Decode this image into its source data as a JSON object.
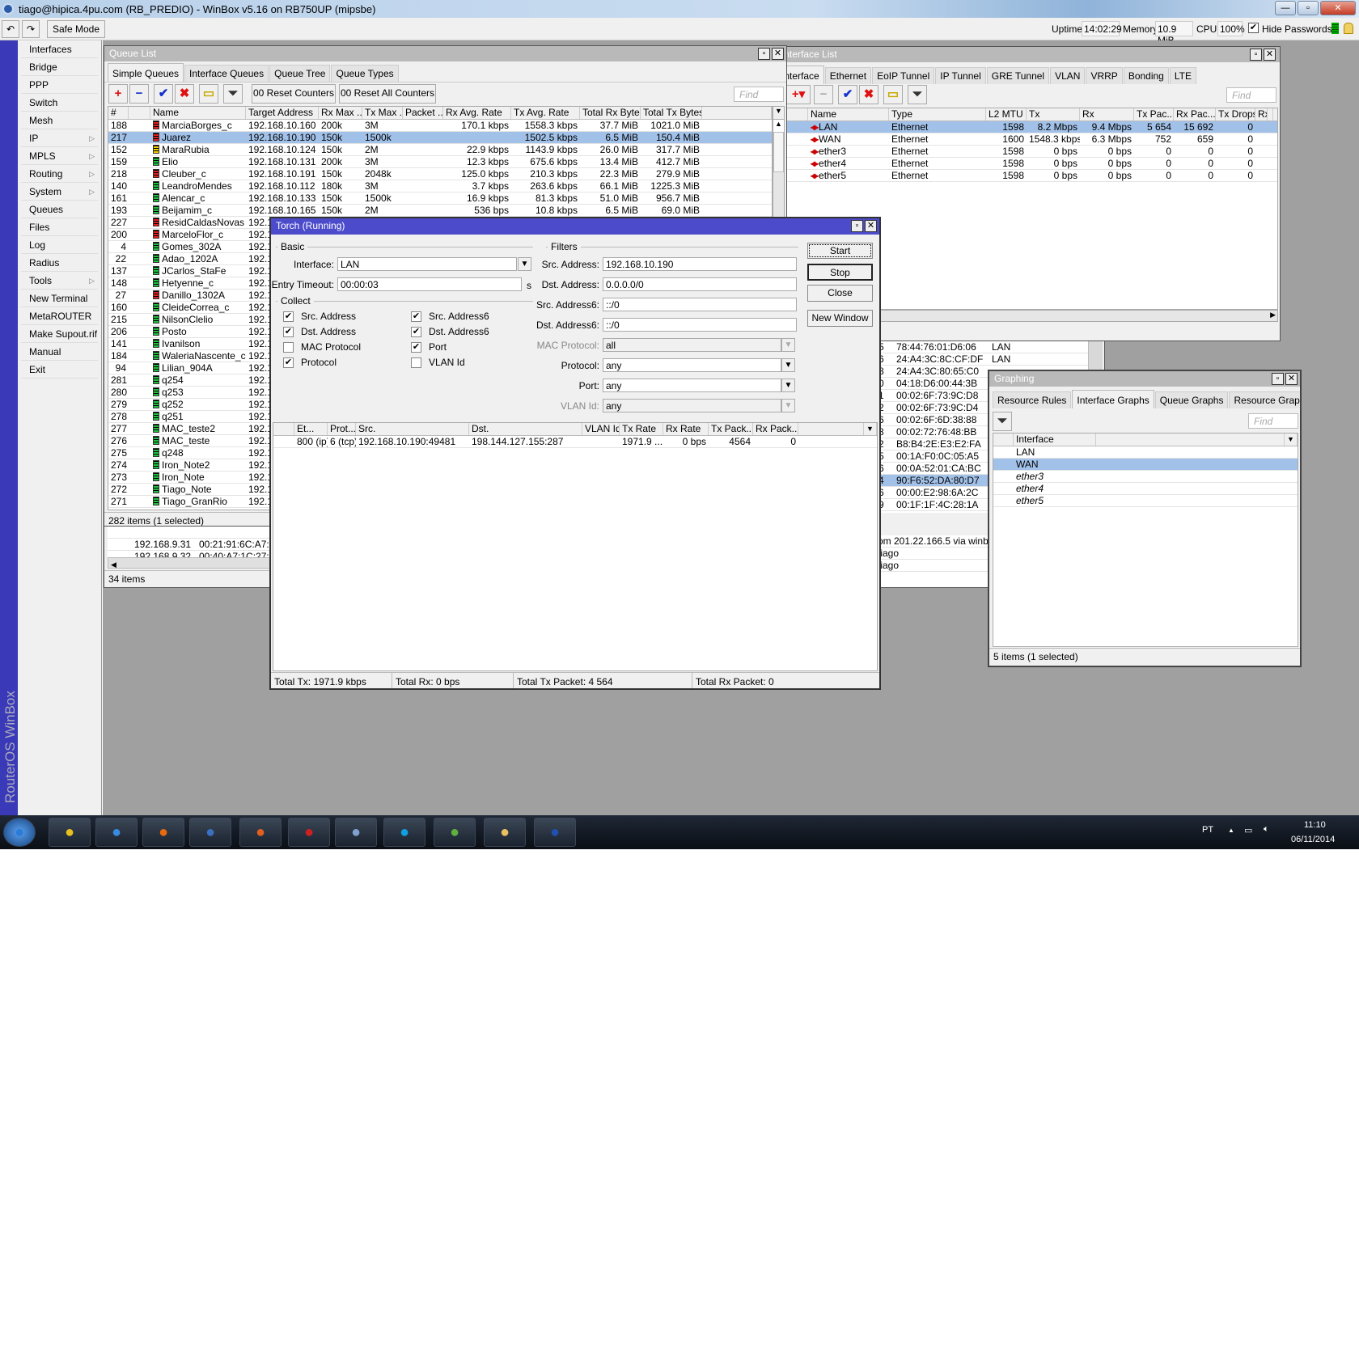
{
  "app": {
    "title": "tiago@hipica.4pu.com (RB_PREDIO) - WinBox v5.16 on RB750UP (mipsbe)",
    "minimize": "—",
    "maximize": "▫",
    "close": "✕"
  },
  "toolbar": {
    "undo": "↶",
    "redo": "↷",
    "safe_mode": "Safe Mode",
    "uptime_label": "Uptime:",
    "uptime": "14:02:29",
    "memory_label": "Memory:",
    "memory": "10.9 MiB",
    "cpu_label": "CPU:",
    "cpu": "100%",
    "hide_passwords": "Hide Passwords",
    "hide_passwords_checked": true
  },
  "sidebar": {
    "brand": "RouterOS WinBox",
    "items": [
      {
        "label": "Interfaces"
      },
      {
        "label": "Bridge"
      },
      {
        "label": "PPP"
      },
      {
        "label": "Switch"
      },
      {
        "label": "Mesh"
      },
      {
        "label": "IP",
        "submenu": true
      },
      {
        "label": "MPLS",
        "submenu": true
      },
      {
        "label": "Routing",
        "submenu": true
      },
      {
        "label": "System",
        "submenu": true
      },
      {
        "label": "Queues"
      },
      {
        "label": "Files"
      },
      {
        "label": "Log"
      },
      {
        "label": "Radius"
      },
      {
        "label": "Tools",
        "submenu": true
      },
      {
        "label": "New Terminal"
      },
      {
        "label": "MetaROUTER"
      },
      {
        "label": "Make Supout.rif"
      },
      {
        "label": "Manual"
      },
      {
        "label": "Exit"
      }
    ]
  },
  "colors": {
    "active_title": "#4b4bcc",
    "selection": "#a2c1e8",
    "desktop": "#a0a0a0",
    "queue_red": "#e02020",
    "queue_yellow": "#f0d000",
    "queue_green": "#20c040"
  },
  "queue_list": {
    "title": "Queue List",
    "tabs": [
      "Simple Queues",
      "Interface Queues",
      "Queue Tree",
      "Queue Types"
    ],
    "reset_counters": "00 Reset Counters",
    "reset_all_counters": "00 Reset All Counters",
    "find_placeholder": "Find",
    "columns": [
      "#",
      "",
      "Name",
      "Target Address",
      "Rx Max ...",
      "Tx Max ...",
      "Packet ...",
      "Rx Avg. Rate",
      "Tx Avg. Rate",
      "Total Rx Bytes",
      "Total Tx Bytes"
    ],
    "rows": [
      {
        "id": "188",
        "status": "red",
        "name": "MarciaBorges_c",
        "target": "192.168.10.160",
        "rx_max": "200k",
        "tx_max": "3M",
        "packet": "",
        "rx_avg": "170.1 kbps",
        "tx_avg": "1558.3 kbps",
        "total_rx": "37.7 MiB",
        "total_tx": "1021.0 MiB"
      },
      {
        "id": "217",
        "status": "red",
        "name": "Juarez",
        "target": "192.168.10.190",
        "rx_max": "150k",
        "tx_max": "1500k",
        "packet": "",
        "rx_avg": "",
        "tx_avg": "1502.5 kbps",
        "total_rx": "6.5 MiB",
        "total_tx": "150.4 MiB",
        "selected": true
      },
      {
        "id": "152",
        "status": "yellow",
        "name": "MaraRubia",
        "target": "192.168.10.124",
        "rx_max": "150k",
        "tx_max": "2M",
        "packet": "",
        "rx_avg": "22.9 kbps",
        "tx_avg": "1143.9 kbps",
        "total_rx": "26.0 MiB",
        "total_tx": "317.7 MiB"
      },
      {
        "id": "159",
        "status": "green",
        "name": "Elio",
        "target": "192.168.10.131",
        "rx_max": "200k",
        "tx_max": "3M",
        "packet": "",
        "rx_avg": "12.3 kbps",
        "tx_avg": "675.6 kbps",
        "total_rx": "13.4 MiB",
        "total_tx": "412.7 MiB"
      },
      {
        "id": "218",
        "status": "red",
        "name": "Cleuber_c",
        "target": "192.168.10.191",
        "rx_max": "150k",
        "tx_max": "2048k",
        "packet": "",
        "rx_avg": "125.0 kbps",
        "tx_avg": "210.3 kbps",
        "total_rx": "22.3 MiB",
        "total_tx": "279.9 MiB"
      },
      {
        "id": "140",
        "status": "green",
        "name": "LeandroMendes",
        "target": "192.168.10.112",
        "rx_max": "180k",
        "tx_max": "3M",
        "packet": "",
        "rx_avg": "3.7 kbps",
        "tx_avg": "263.6 kbps",
        "total_rx": "66.1 MiB",
        "total_tx": "1225.3 MiB"
      },
      {
        "id": "161",
        "status": "green",
        "name": "Alencar_c",
        "target": "192.168.10.133",
        "rx_max": "150k",
        "tx_max": "1500k",
        "packet": "",
        "rx_avg": "16.9 kbps",
        "tx_avg": "81.3 kbps",
        "total_rx": "51.0 MiB",
        "total_tx": "956.7 MiB"
      },
      {
        "id": "193",
        "status": "green",
        "name": "Beijamim_c",
        "target": "192.168.10.165",
        "rx_max": "150k",
        "tx_max": "2M",
        "packet": "",
        "rx_avg": "536 bps",
        "tx_avg": "10.8 kbps",
        "total_rx": "6.5 MiB",
        "total_tx": "69.0 MiB"
      },
      {
        "id": "227",
        "status": "red",
        "name": "ResidCaldasNovas",
        "target": "192.1"
      },
      {
        "id": "200",
        "status": "red",
        "name": "MarceloFlor_c",
        "target": "192.1"
      },
      {
        "id": "4",
        "status": "green",
        "name": "Gomes_302A",
        "target": "192.1"
      },
      {
        "id": "22",
        "status": "green",
        "name": "Adao_1202A",
        "target": "192.1"
      },
      {
        "id": "137",
        "status": "green",
        "name": "JCarlos_StaFe",
        "target": "192.1"
      },
      {
        "id": "148",
        "status": "green",
        "name": "Hetyenne_c",
        "target": "192.1"
      },
      {
        "id": "27",
        "status": "red",
        "name": "Danillo_1302A",
        "target": "192.1"
      },
      {
        "id": "160",
        "status": "green",
        "name": "CleideCorrea_c",
        "target": "192.1"
      },
      {
        "id": "215",
        "status": "green",
        "name": "NilsonClelio",
        "target": "192.1"
      },
      {
        "id": "206",
        "status": "green",
        "name": "Posto",
        "target": "192.1"
      },
      {
        "id": "141",
        "status": "green",
        "name": "Ivanilson",
        "target": "192.1"
      },
      {
        "id": "184",
        "status": "green",
        "name": "WaleriaNascente_c",
        "target": "192.1"
      },
      {
        "id": "94",
        "status": "green",
        "name": "Lilian_904A",
        "target": "192.1"
      },
      {
        "id": "281",
        "status": "green",
        "name": "q254",
        "target": "192.1"
      },
      {
        "id": "280",
        "status": "green",
        "name": "q253",
        "target": "192.1"
      },
      {
        "id": "279",
        "status": "green",
        "name": "q252",
        "target": "192.1"
      },
      {
        "id": "278",
        "status": "green",
        "name": "q251",
        "target": "192.1"
      },
      {
        "id": "277",
        "status": "green",
        "name": "MAC_teste2",
        "target": "192.1"
      },
      {
        "id": "276",
        "status": "green",
        "name": "MAC_teste",
        "target": "192.1"
      },
      {
        "id": "275",
        "status": "green",
        "name": "q248",
        "target": "192.1"
      },
      {
        "id": "274",
        "status": "green",
        "name": "Iron_Note2",
        "target": "192.1"
      },
      {
        "id": "273",
        "status": "green",
        "name": "Iron_Note",
        "target": "192.1"
      },
      {
        "id": "272",
        "status": "green",
        "name": "Tiago_Note",
        "target": "192.1"
      },
      {
        "id": "271",
        "status": "green",
        "name": "Tiago_GranRio",
        "target": "192.1"
      }
    ],
    "status": "282 items (1 selected)"
  },
  "arp_partial": {
    "rows": [
      {
        "address": "192.168.9.31",
        "mac": "00:21:91:6C:A7:91"
      },
      {
        "address": "192.168.9.32",
        "mac": "00:40:A7:1C:27:81"
      }
    ],
    "status": "34 items"
  },
  "interface_list": {
    "title": "Interface List",
    "tabs": [
      "Interface",
      "Ethernet",
      "EoIP Tunnel",
      "IP Tunnel",
      "GRE Tunnel",
      "VLAN",
      "VRRP",
      "Bonding",
      "LTE"
    ],
    "find_placeholder": "Find",
    "columns": [
      "",
      "Name",
      "Type",
      "L2 MTU",
      "Tx",
      "Rx",
      "Tx Pac...",
      "Rx Pac...",
      "Tx Drops",
      "Rx"
    ],
    "rows": [
      {
        "flag": "R",
        "name": "LAN",
        "type": "Ethernet",
        "l2mtu": "1598",
        "tx": "8.2 Mbps",
        "rx": "9.4 Mbps",
        "tx_pac": "5 654",
        "rx_pac": "15 692",
        "tx_drops": "0",
        "selected": true
      },
      {
        "flag": "R",
        "name": "WAN",
        "type": "Ethernet",
        "l2mtu": "1600",
        "tx": "1548.3 kbps",
        "rx": "6.3 Mbps",
        "tx_pac": "752",
        "rx_pac": "659",
        "tx_drops": "0"
      },
      {
        "flag": "",
        "name": "ether3",
        "type": "Ethernet",
        "l2mtu": "1598",
        "tx": "0 bps",
        "rx": "0 bps",
        "tx_pac": "0",
        "rx_pac": "0",
        "tx_drops": "0"
      },
      {
        "flag": "",
        "name": "ether4",
        "type": "Ethernet",
        "l2mtu": "1598",
        "tx": "0 bps",
        "rx": "0 bps",
        "tx_pac": "0",
        "rx_pac": "0",
        "tx_drops": "0"
      },
      {
        "flag": "",
        "name": "ether5",
        "type": "Ethernet",
        "l2mtu": "1598",
        "tx": "0 bps",
        "rx": "0 bps",
        "tx_pac": "0",
        "rx_pac": "0",
        "tx_drops": "0"
      }
    ]
  },
  "mac_partial": {
    "rows": [
      {
        "n": "5",
        "mac": "78:44:76:01:D6:06",
        "iface": "LAN"
      },
      {
        "n": "6",
        "mac": "24:A4:3C:8C:CF:DF",
        "iface": "LAN"
      },
      {
        "n": "8",
        "mac": "24:A4:3C:80:65:C0"
      },
      {
        "n": "0",
        "mac": "04:18:D6:00:44:3B"
      },
      {
        "n": "1",
        "mac": "00:02:6F:73:9C:D8"
      },
      {
        "n": "2",
        "mac": "00:02:6F:73:9C:D4"
      },
      {
        "n": "6",
        "mac": "00:02:6F:6D:38:88"
      },
      {
        "n": "8",
        "mac": "00:02:72:76:48:BB"
      },
      {
        "n": "2",
        "mac": "B8:B4:2E:E3:E2:FA"
      },
      {
        "n": "5",
        "mac": "00:1A:F0:0C:05:A5"
      },
      {
        "n": "6",
        "mac": "00:0A:52:01:CA:BC"
      },
      {
        "n": "4",
        "mac": "90:F6:52:DA:80:D7",
        "selected": true
      },
      {
        "n": "6",
        "mac": "00:00:E2:98:6A:2C"
      },
      {
        "n": "9",
        "mac": "00:1F:1F:4C:28:1A"
      }
    ],
    "log": [
      "om 201.22.166.5 via winbox",
      "tiago",
      "tiago"
    ]
  },
  "torch": {
    "title": "Torch (Running)",
    "basic_legend": "Basic",
    "interface_label": "Interface:",
    "interface_value": "LAN",
    "entry_timeout_label": "Entry Timeout:",
    "entry_timeout_value": "00:00:03",
    "entry_timeout_unit": "s",
    "collect_legend": "Collect",
    "collect": [
      {
        "label": "Src. Address",
        "checked": true
      },
      {
        "label": "Dst. Address",
        "checked": true
      },
      {
        "label": "MAC Protocol",
        "checked": false
      },
      {
        "label": "Protocol",
        "checked": true
      },
      {
        "label": "Src. Address6",
        "checked": true
      },
      {
        "label": "Dst. Address6",
        "checked": true
      },
      {
        "label": "Port",
        "checked": true
      },
      {
        "label": "VLAN Id",
        "checked": false
      }
    ],
    "filters_legend": "Filters",
    "filters": [
      {
        "label": "Src. Address:",
        "value": "192.168.10.190"
      },
      {
        "label": "Dst. Address:",
        "value": "0.0.0.0/0"
      },
      {
        "label": "Src. Address6:",
        "value": "::/0"
      },
      {
        "label": "Dst. Address6:",
        "value": "::/0"
      },
      {
        "label": "MAC Protocol:",
        "value": "all",
        "dropdown": true,
        "disabled": true
      },
      {
        "label": "Protocol:",
        "value": "any",
        "dropdown": true
      },
      {
        "label": "Port:",
        "value": "any",
        "dropdown": true
      },
      {
        "label": "VLAN Id:",
        "value": "any",
        "dropdown": true,
        "disabled": true
      }
    ],
    "buttons": {
      "start": "Start",
      "stop": "Stop",
      "close": "Close",
      "new_window": "New Window"
    },
    "columns": [
      "",
      "Et...",
      "Prot...",
      "Src.",
      "Dst.",
      "VLAN Id",
      "Tx Rate",
      "Rx Rate",
      "Tx Pack...",
      "Rx Pack..."
    ],
    "rows": [
      {
        "eth": "800 (ip)",
        "proto": "6 (tcp)",
        "src": "192.168.10.190:49481",
        "dst": "198.144.127.155:287",
        "vlan": "",
        "tx_rate": "1971.9 ...",
        "rx_rate": "0 bps",
        "tx_pack": "4564",
        "rx_pack": "0"
      }
    ],
    "totals": {
      "tx": "Total Tx: 1971.9 kbps",
      "rx": "Total Rx: 0 bps",
      "tx_packet": "Total Tx Packet: 4 564",
      "rx_packet": "Total Rx Packet: 0"
    }
  },
  "graphing": {
    "title": "Graphing",
    "tabs": [
      "Resource Rules",
      "Interface Graphs",
      "Queue Graphs",
      "Resource Graphs",
      "..."
    ],
    "find_placeholder": "Find",
    "columns": [
      "",
      "Interface"
    ],
    "rows": [
      {
        "iface": "LAN"
      },
      {
        "iface": "WAN",
        "selected": true
      },
      {
        "iface": "ether3",
        "italic": true
      },
      {
        "iface": "ether4",
        "italic": true
      },
      {
        "iface": "ether5",
        "italic": true
      }
    ],
    "status": "5 items (1 selected)"
  },
  "taskbar": {
    "apps": [
      "start-orb",
      "chrome",
      "internet-explorer",
      "firefox",
      "winbox",
      "remote-desktop",
      "app-red",
      "paint",
      "skype",
      "network-tool",
      "file-explorer",
      "word"
    ],
    "language": "PT",
    "time": "11:10",
    "date": "06/11/2014"
  }
}
